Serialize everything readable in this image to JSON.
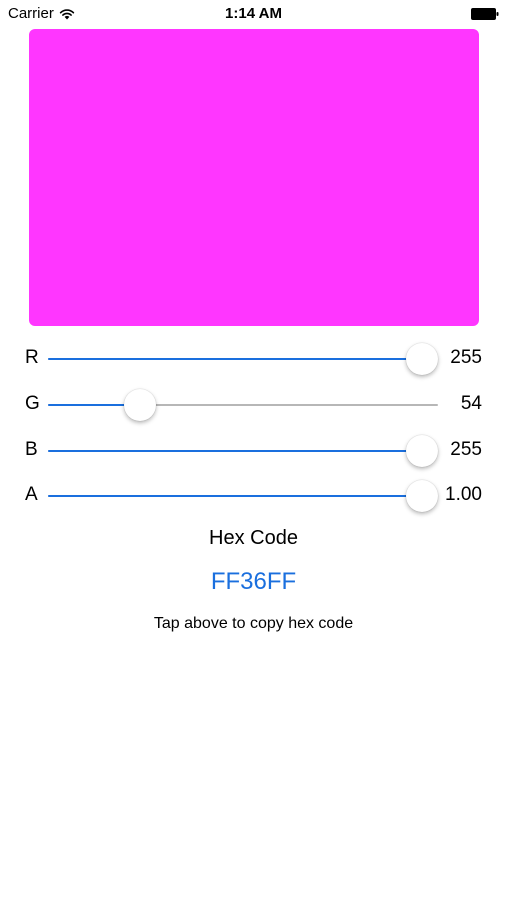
{
  "status_bar": {
    "carrier": "Carrier",
    "time": "1:14 AM",
    "wifi_icon": "wifi-icon",
    "battery_icon": "battery-icon"
  },
  "preview": {
    "color": "#FF36FF"
  },
  "sliders": [
    {
      "label": "R",
      "value": "255",
      "fraction": 1.0
    },
    {
      "label": "G",
      "value": "54",
      "fraction": 0.212
    },
    {
      "label": "B",
      "value": "255",
      "fraction": 1.0
    },
    {
      "label": "A",
      "value": "1.00",
      "fraction": 1.0
    }
  ],
  "hex": {
    "title": "Hex Code",
    "code": "FF36FF",
    "hint": "Tap above to copy hex code"
  },
  "colors": {
    "accent": "#1a6fde",
    "track_inactive": "#b7b7b7"
  }
}
